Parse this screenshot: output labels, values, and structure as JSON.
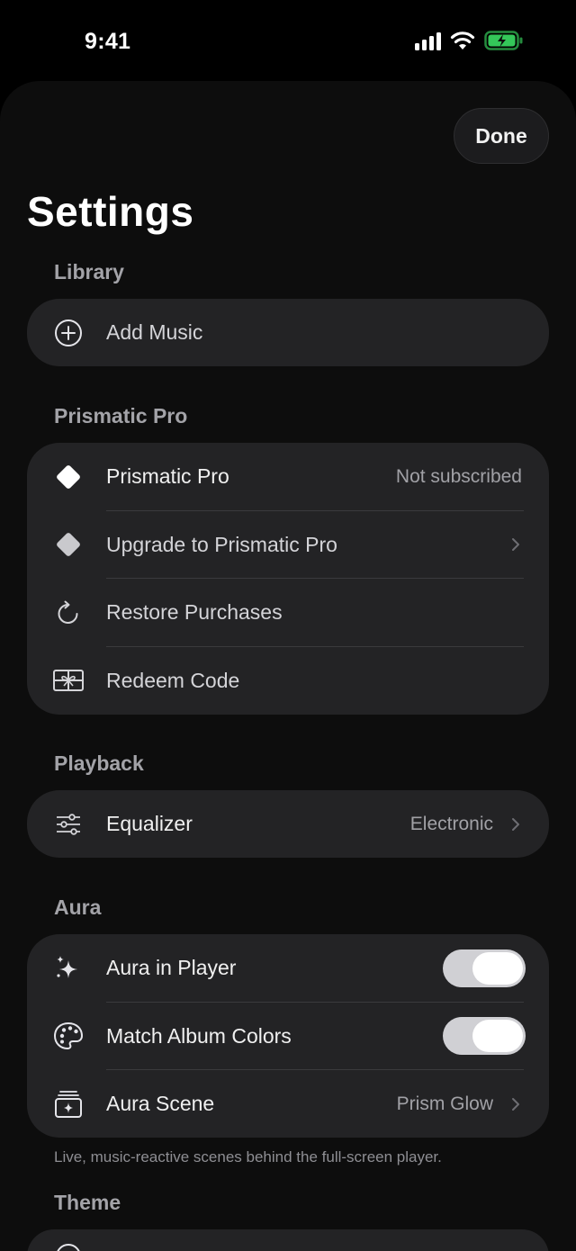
{
  "status_bar": {
    "time": "9:41"
  },
  "header": {
    "done_label": "Done",
    "title": "Settings"
  },
  "sections": {
    "library": {
      "header": "Library",
      "rows": [
        {
          "label": "Add Music",
          "icon": "plus-circle-icon"
        }
      ]
    },
    "pro": {
      "header": "Prismatic Pro",
      "rows": [
        {
          "label": "Prismatic Pro",
          "value": "Not subscribed",
          "icon": "diamond-icon"
        },
        {
          "label": "Upgrade to Prismatic Pro",
          "icon": "diamond-icon"
        },
        {
          "label": "Restore Purchases",
          "icon": "refresh-icon"
        },
        {
          "label": "Redeem Code",
          "icon": "gift-card-icon"
        }
      ]
    },
    "playback": {
      "header": "Playback",
      "rows": [
        {
          "label": "Equalizer",
          "value": "Electronic",
          "icon": "sliders-icon"
        }
      ]
    },
    "aura": {
      "header": "Aura",
      "rows": [
        {
          "label": "Aura in Player",
          "toggle_on": true,
          "icon": "sparkles-icon"
        },
        {
          "label": "Match Album Colors",
          "toggle_on": true,
          "icon": "palette-icon"
        },
        {
          "label": "Aura Scene",
          "value": "Prism Glow",
          "icon": "scene-stack-icon"
        }
      ],
      "footnote": "Live, music-reactive scenes behind the full-screen player."
    },
    "theme": {
      "header": "Theme"
    }
  },
  "colors": {
    "background": "#000000",
    "sheet": "#0d0d0d",
    "group": "#232325",
    "toggle_on": "#d0d0d4"
  }
}
